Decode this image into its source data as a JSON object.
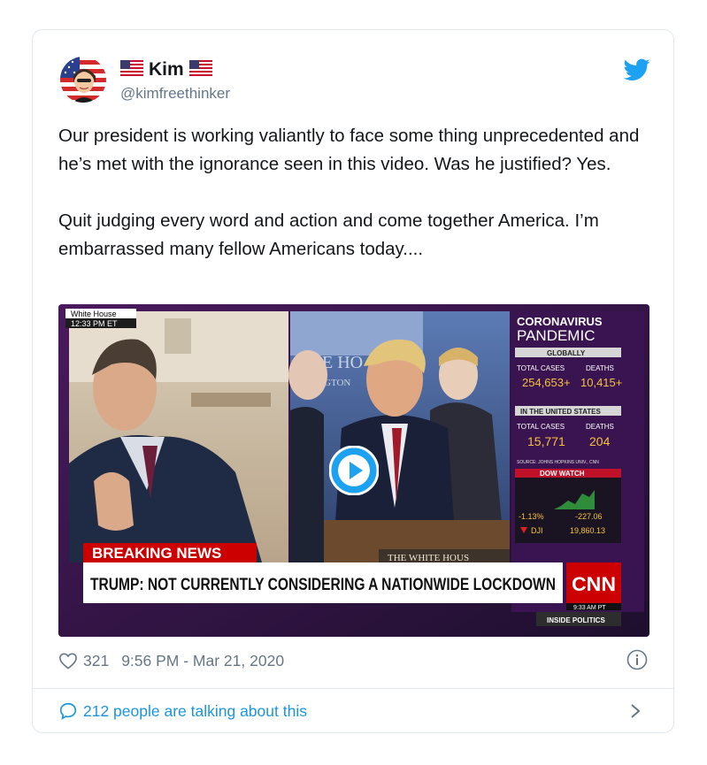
{
  "user": {
    "display_name": "Kim",
    "handle": "@kimfreethinker"
  },
  "tweet": {
    "paragraphs": [
      "Our president is working valiantly to face some thing unprecedented and he’s met with the ignorance seen in this video.  Was he justified?  Yes.",
      "Quit judging every word and action and come together America. I’m embarrassed many fellow Americans today...."
    ]
  },
  "video": {
    "location_label": "White House",
    "location_time": "12:33 PM ET",
    "backdrop_text": "E HO",
    "backdrop_text2": "GTON",
    "panel": {
      "title_line1": "CORONAVIRUS",
      "title_line2": "PANDEMIC",
      "globally_label": "GLOBALLY",
      "total_cases_label": "TOTAL CASES",
      "deaths_label": "DEATHS",
      "global_cases": "254,653+",
      "global_deaths": "10,415+",
      "us_label": "IN THE UNITED STATES",
      "us_cases": "15,771",
      "us_deaths": "204",
      "source": "SOURCE: JOHNS HOPKINS UNIV., CNN",
      "dow_label": "DOW WATCH",
      "dow_pct": "-1.13%",
      "dow_points": "-227.06",
      "dow_index": "DJI",
      "dow_value": "19,860.13"
    },
    "breaking": "BREAKING NEWS",
    "podium": "THE WHITE HOUS",
    "headline": "TRUMP: NOT CURRENTLY CONSIDERING A NATIONWIDE LOCKDOWN",
    "network_logo": "CNN",
    "clock": "9:33 AM PT",
    "show": "INSIDE POLITICS"
  },
  "meta": {
    "likes": "321",
    "timestamp": "9:56 PM - Mar 21, 2020"
  },
  "conversation": {
    "label": "212 people are talking about this"
  },
  "icons": {
    "brand": "twitter-bird-icon",
    "like": "heart-icon",
    "info": "info-icon",
    "reply": "speech-bubble-icon",
    "chevron": "chevron-right-icon",
    "flag": "us-flag-icon",
    "play": "play-icon"
  },
  "colors": {
    "twitter_blue": "#1da1f2",
    "link_blue": "#1b95e0",
    "breaking_red": "#cc0000",
    "muted_gray": "#657786",
    "border": "#e1e8ed",
    "panel_bg": "#3a1450"
  }
}
